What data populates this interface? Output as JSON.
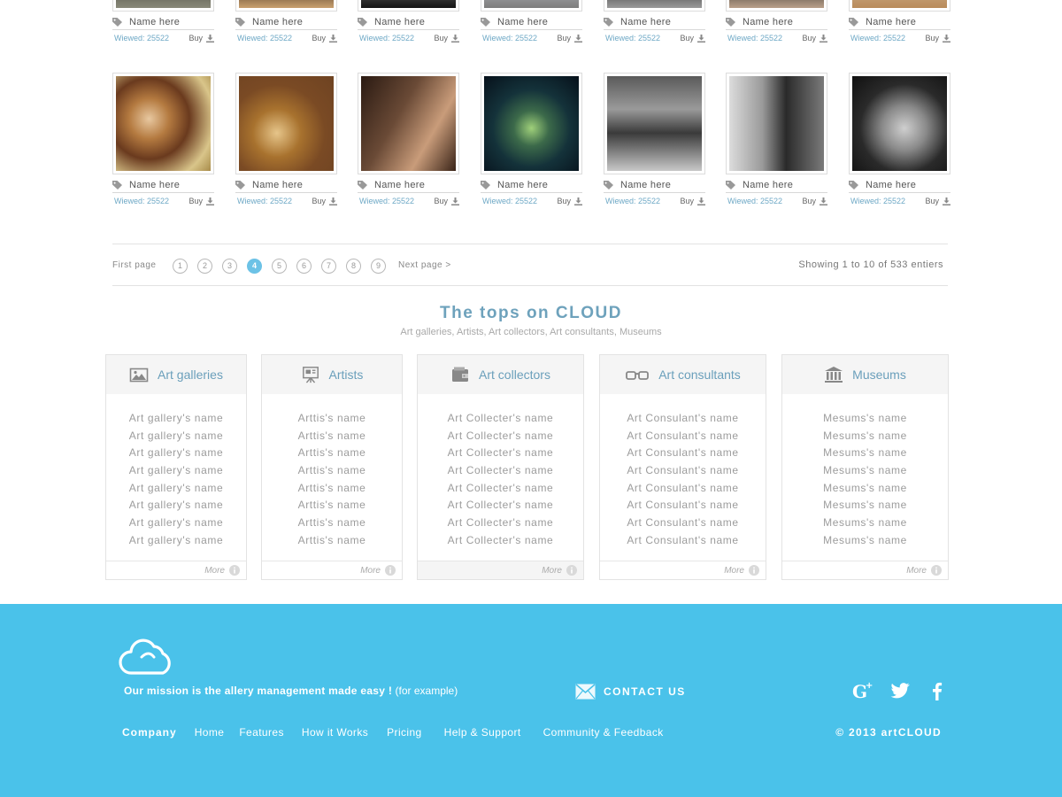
{
  "gallery": {
    "rows": [
      {
        "cards": [
          {
            "name": "Name here",
            "viewed": "Wiewed: 25522",
            "buy": "Buy"
          },
          {
            "name": "Name here",
            "viewed": "Wiewed: 25522",
            "buy": "Buy"
          },
          {
            "name": "Name here",
            "viewed": "Wiewed: 25522",
            "buy": "Buy"
          },
          {
            "name": "Name here",
            "viewed": "Wiewed: 25522",
            "buy": "Buy"
          },
          {
            "name": "Name here",
            "viewed": "Wiewed: 25522",
            "buy": "Buy"
          },
          {
            "name": "Name here",
            "viewed": "Wiewed: 25522",
            "buy": "Buy"
          },
          {
            "name": "Name here",
            "viewed": "Wiewed: 25522",
            "buy": "Buy"
          }
        ]
      },
      {
        "cards": [
          {
            "name": "Name here",
            "viewed": "Wiewed: 25522",
            "buy": "Buy"
          },
          {
            "name": "Name here",
            "viewed": "Wiewed: 25522",
            "buy": "Buy"
          },
          {
            "name": "Name here",
            "viewed": "Wiewed: 25522",
            "buy": "Buy"
          },
          {
            "name": "Name here",
            "viewed": "Wiewed: 25522",
            "buy": "Buy"
          },
          {
            "name": "Name here",
            "viewed": "Wiewed: 25522",
            "buy": "Buy"
          },
          {
            "name": "Name here",
            "viewed": "Wiewed: 25522",
            "buy": "Buy"
          },
          {
            "name": "Name here",
            "viewed": "Wiewed: 25522",
            "buy": "Buy"
          }
        ]
      }
    ]
  },
  "pagination": {
    "first": "First page",
    "pages": [
      "1",
      "2",
      "3",
      "4",
      "5",
      "6",
      "7",
      "8",
      "9"
    ],
    "active_page": "4",
    "next": "Next page >",
    "showing": "Showing 1 to 10 of 533 entiers"
  },
  "tops": {
    "title": "The tops on CLOUD",
    "subtitle": "Art galleries,  Artists, Art collectors, Art consultants, Museums",
    "panels": [
      {
        "title": "Art galleries",
        "icon": "picture-icon",
        "more": "More",
        "items": [
          "Art gallery's name",
          "Art gallery's name",
          "Art gallery's name",
          "Art gallery's name",
          "Art gallery's name",
          "Art gallery's name",
          "Art gallery's name",
          "Art gallery's name"
        ]
      },
      {
        "title": "Artists",
        "icon": "easel-icon",
        "more": "More",
        "items": [
          "Arttis's name",
          "Arttis's name",
          "Arttis's name",
          "Arttis's name",
          "Arttis's name",
          "Arttis's name",
          "Arttis's name",
          "Arttis's name"
        ]
      },
      {
        "title": "Art collectors",
        "icon": "wallet-icon",
        "more": "More",
        "items": [
          "Art Collecter's name",
          "Art Collecter's name",
          "Art Collecter's name",
          "Art Collecter's name",
          "Art Collecter's name",
          "Art Collecter's name",
          "Art Collecter's name",
          "Art Collecter's name"
        ]
      },
      {
        "title": "Art consultants",
        "icon": "glasses-icon",
        "more": "More",
        "items": [
          "Art Consulant's name",
          "Art Consulant's name",
          "Art Consulant's name",
          "Art Consulant's name",
          "Art Consulant's name",
          "Art Consulant's name",
          "Art Consulant's name",
          "Art Consulant's name"
        ]
      },
      {
        "title": "Museums",
        "icon": "museum-icon",
        "more": "More",
        "items": [
          "Mesums's name",
          "Mesums's name",
          "Mesums's name",
          "Mesums's name",
          "Mesums's name",
          "Mesums's name",
          "Mesums's name",
          "Mesums's name"
        ]
      }
    ]
  },
  "footer": {
    "mission_bold": "Our mission is the allery management made easy !",
    "mission_extra": " (for example)",
    "contact": "CONTACT US",
    "company_label": "Company",
    "nav": [
      "Home",
      "Features",
      "How it Works",
      "Pricing",
      "Help & Support",
      "Community & Feedback"
    ],
    "copyright": "© 2013 artCLOUD",
    "social": [
      "google-plus-icon",
      "twitter-icon",
      "facebook-icon"
    ]
  },
  "colors": {
    "accent": "#6cc2e6",
    "footer_bg": "#4ac2ea",
    "title_blue": "#6ea2bc",
    "viewed_blue": "#6fa9c6"
  }
}
